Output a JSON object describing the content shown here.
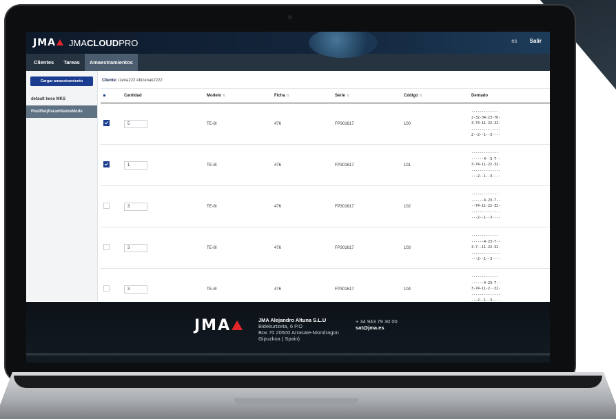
{
  "header": {
    "logo_text": "JMA",
    "brand_prefix": "JMA",
    "brand_bold": "CLOUD",
    "brand_suffix": "PRO",
    "language": "es",
    "logout_label": "Salir"
  },
  "nav": {
    "tabs": [
      {
        "label": "Clientes",
        "active": false
      },
      {
        "label": "Tareas",
        "active": false
      },
      {
        "label": "Amaestramientos",
        "active": true
      }
    ]
  },
  "sidebar": {
    "load_button": "Cargar amaestramiento",
    "items": [
      {
        "label": "default keso MKS",
        "active": false
      },
      {
        "label": "PostReqParamNameMode",
        "active": true
      }
    ]
  },
  "client": {
    "label": "Cliente:",
    "value": "Izena222 Abizenak2222"
  },
  "table": {
    "headers": [
      "Cantidad",
      "Modelo",
      "Ficha",
      "Serie",
      "Código",
      "Dentado"
    ],
    "rows": [
      {
        "checked": true,
        "cantidad": "5",
        "modelo": "TE-8I",
        "ficha": "476",
        "serie": "FP301617",
        "codigo": "100",
        "dentado": "-------------\n2-32-34-23-70-\n3-74-11-22-32-\n--------------\n2--2--1--3----"
      },
      {
        "checked": true,
        "cantidad": "1",
        "modelo": "TE-8I",
        "ficha": "476",
        "serie": "FP301617",
        "codigo": "101",
        "dentado": "-------------\n------4--3-7--\n3-74-11-22-32-\n--------------\n---2--1--3----"
      },
      {
        "checked": false,
        "cantidad": "3",
        "modelo": "TE-8I",
        "ficha": "476",
        "serie": "FP301617",
        "codigo": "102",
        "dentado": "-------------\n------4-23-7--\n--74-11-22-32-\n--------------\n---2--1--3----"
      },
      {
        "checked": false,
        "cantidad": "3",
        "modelo": "TE-8I",
        "ficha": "476",
        "serie": "FP301617",
        "codigo": "103",
        "dentado": "-------------\n------4-23-7--\n3-7--11-22-32-\n--------------\n---2--1--3----"
      },
      {
        "checked": false,
        "cantidad": "3",
        "modelo": "TE-8I",
        "ficha": "476",
        "serie": "FP301617",
        "codigo": "104",
        "dentado": "-------------\n------4-23-7--\n3-74-11-2--32-\n--------------\n---2--1--3----"
      }
    ]
  },
  "footer": {
    "logo_text": "JMA",
    "company_name": "JMA Alejandro Altuna S.L.U",
    "address_1": "Bidekurtzeta, 6 P.O",
    "address_2": "Box 70 20500 Arrasate-Mondragon",
    "address_3": "Gipuzkoa ( Spain)",
    "phone": "+ 34 943 79 30 00",
    "email": "sat@jma.es"
  }
}
